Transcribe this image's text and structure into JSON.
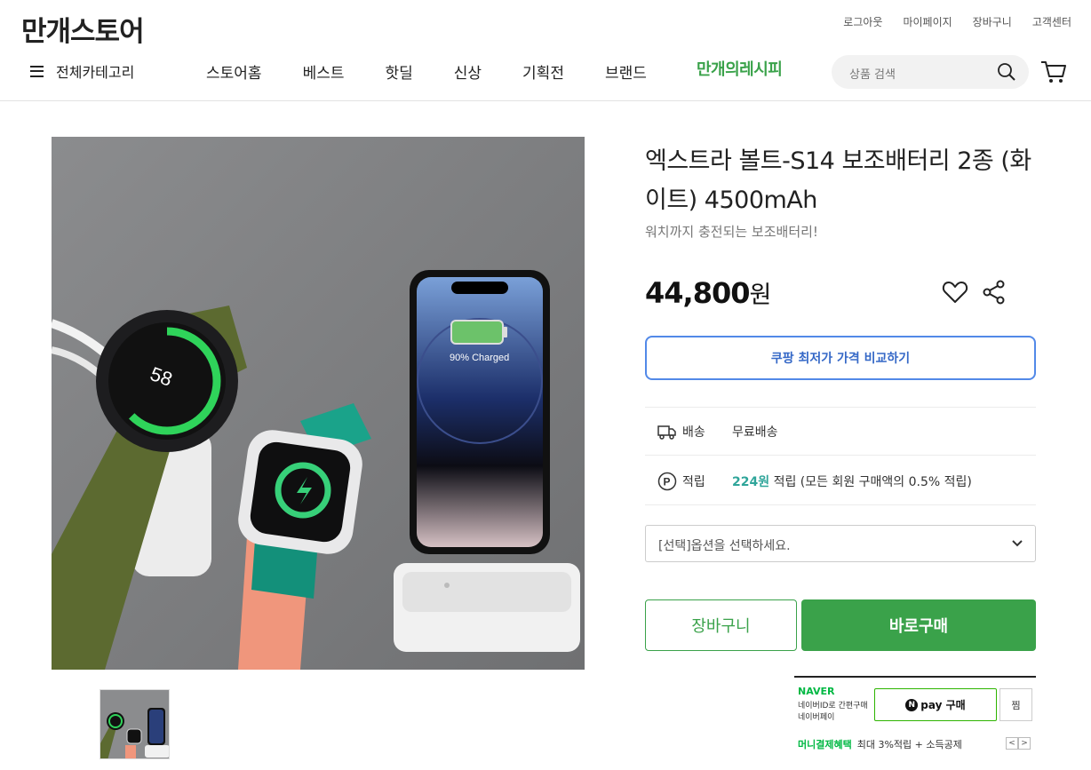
{
  "header": {
    "logo": "만개스토어",
    "util_links": [
      "로그아웃",
      "마이페이지",
      "장바구니",
      "고객센터"
    ],
    "all_category": "전체카테고리",
    "nav": [
      "스토어홈",
      "베스트",
      "핫딜",
      "신상",
      "기획전",
      "브랜드"
    ],
    "recipe_link": "만개의레시피",
    "search_placeholder": "상품 검색"
  },
  "product": {
    "title": "엑스트라 볼트-S14 보조배터리 2종 (화이트) 4500mAh",
    "subtitle": "워치까지 충전되는 보조배터리!",
    "price": "44,800",
    "price_unit": "원",
    "compare_button": "쿠팡 최저가 가격 비교하기",
    "image_caption": "90% Charged",
    "watch_value": "58",
    "shipping_label": "배송",
    "shipping_value": "무료배송",
    "points_label": "적립",
    "points_value": "224원",
    "points_desc": "적립 (모든 회원 구매액의 0.5% 적립)",
    "option_placeholder": "[선택]옵션을 선택하세요.",
    "cart_button": "장바구니",
    "buy_button": "바로구매"
  },
  "npay": {
    "brand": "NAVER",
    "desc1": "네이버ID로 간편구매",
    "desc2": "네이버페이",
    "pay_label": "pay 구매",
    "zzim": "찜",
    "benefit_label": "머니결제혜택",
    "benefit_text": "최대 3%적립 + 소득공제"
  },
  "colors": {
    "brand_green": "#3aa24a",
    "compare_blue": "#5289e8",
    "points_teal": "#2fa59a",
    "naver_green": "#00b843"
  }
}
